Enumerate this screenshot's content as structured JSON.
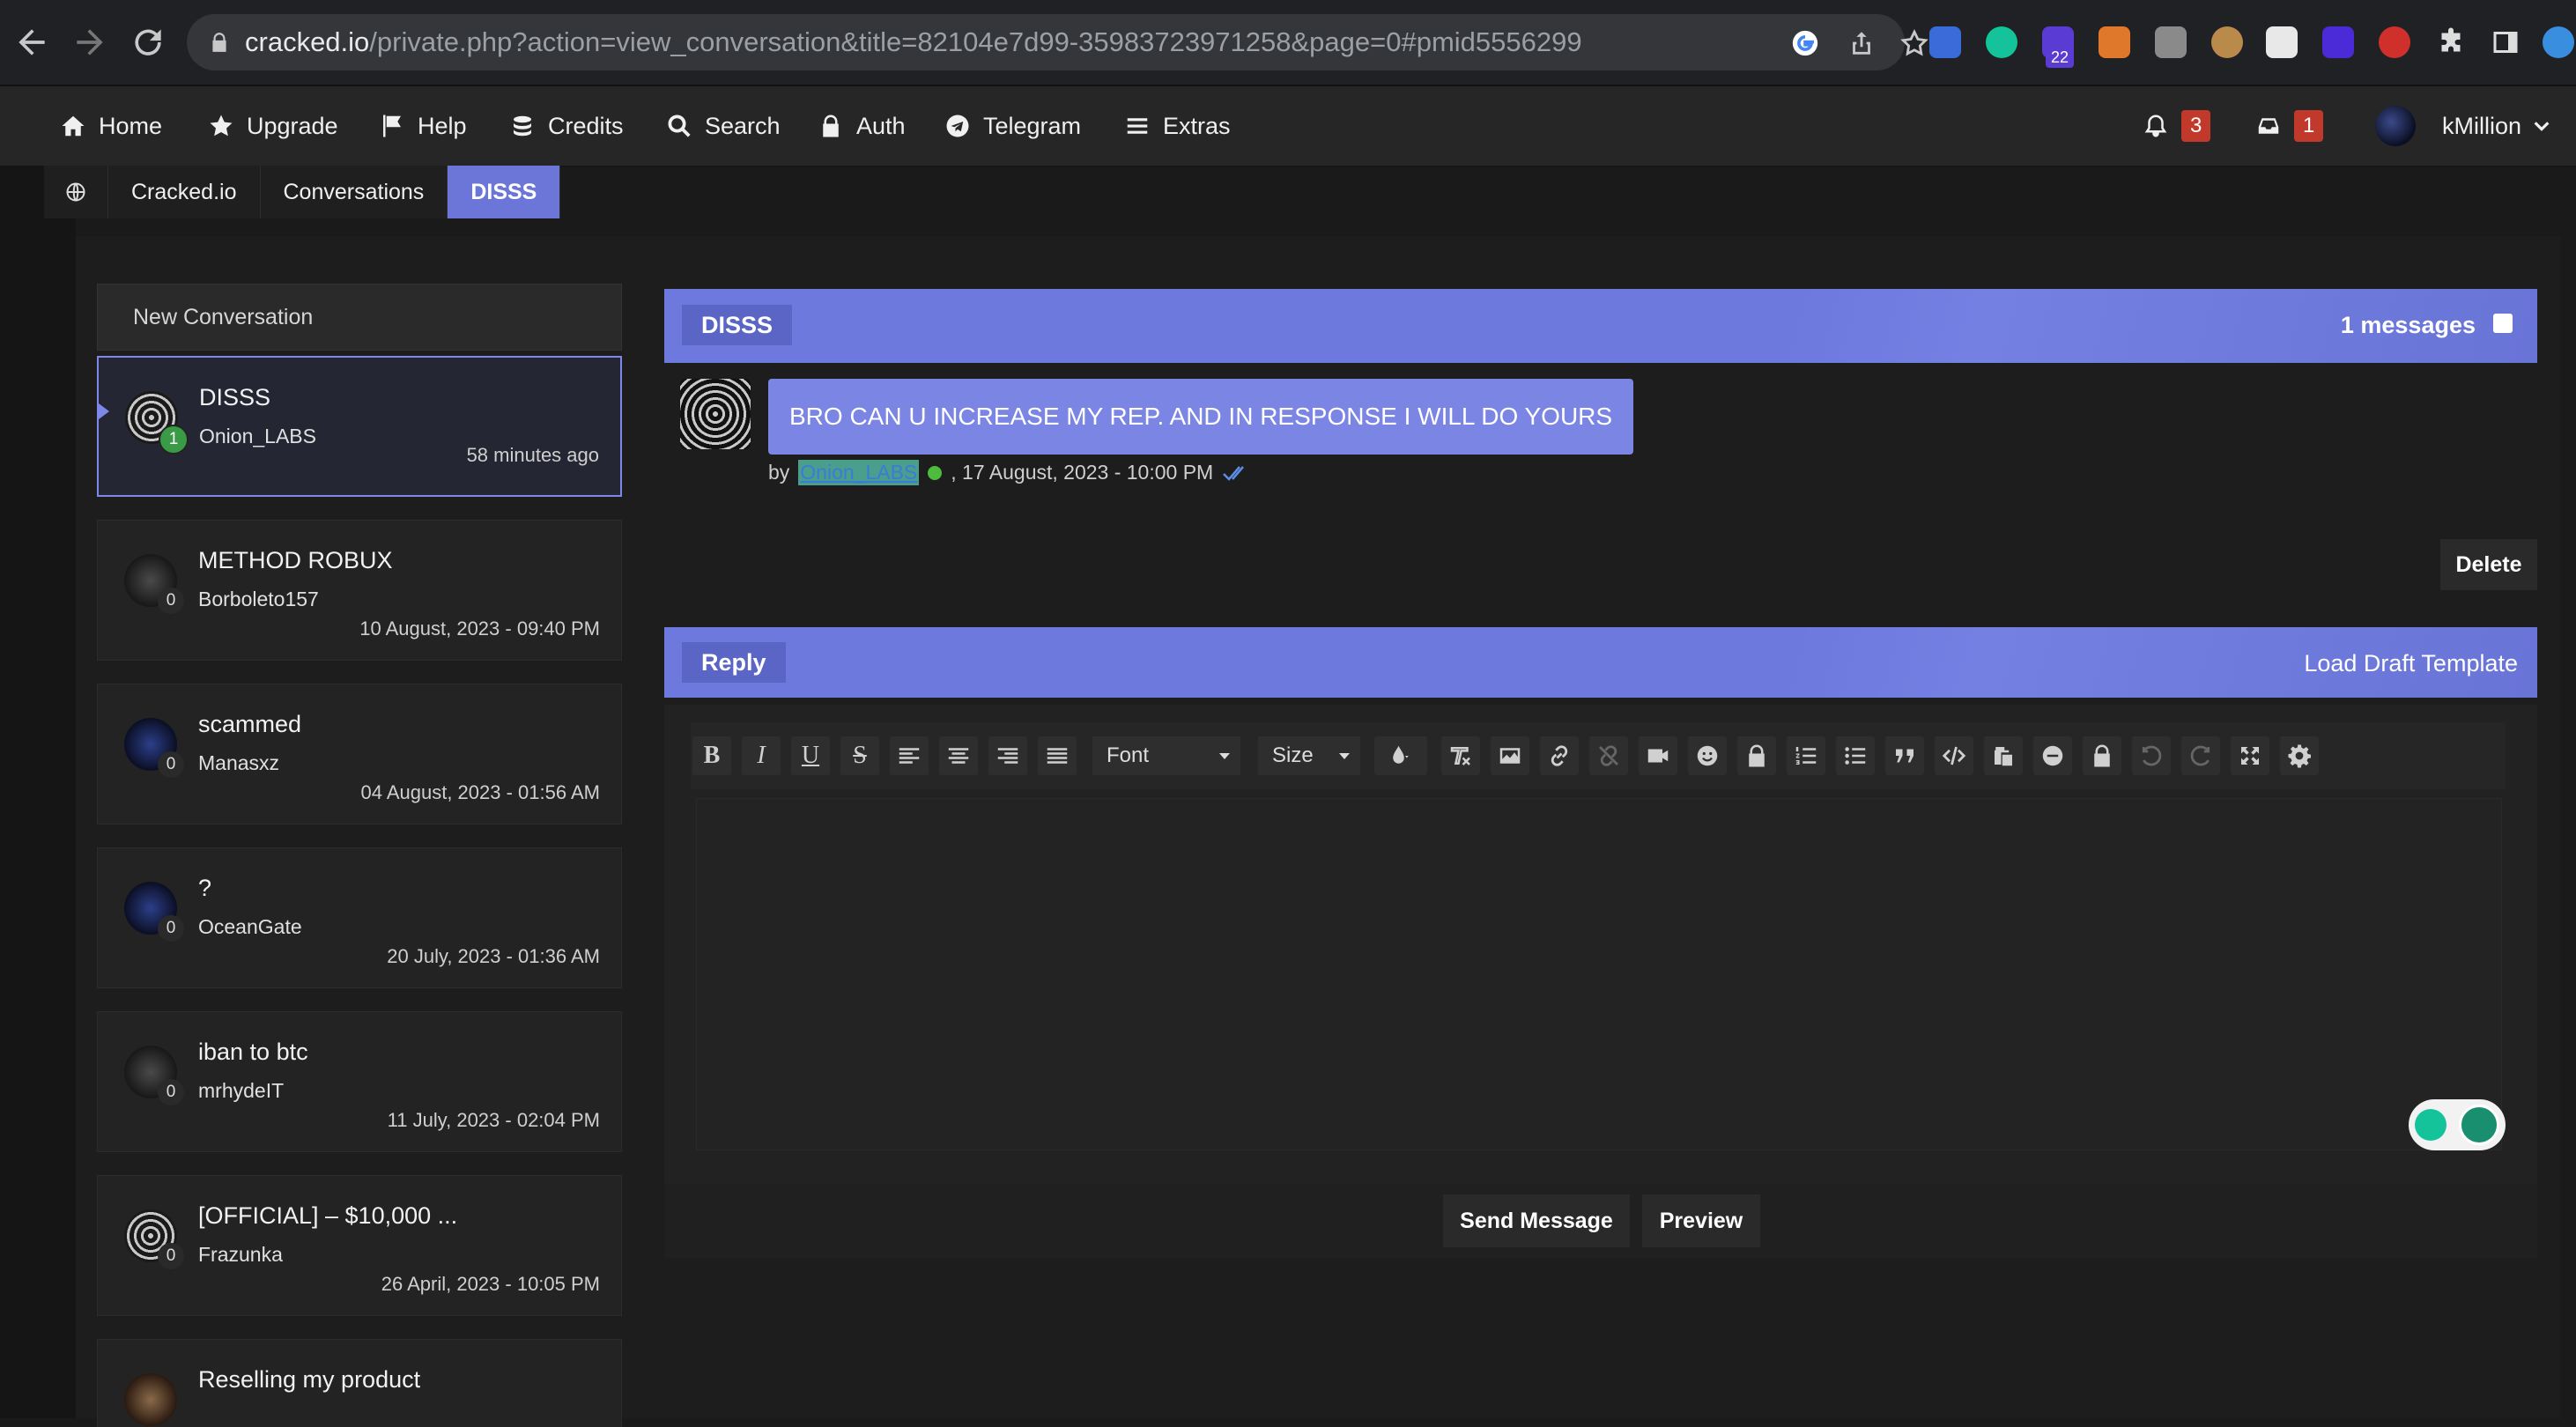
{
  "browser": {
    "url_host": "cracked.io",
    "url_path": "/private.php?action=view_conversation&title=82104e7d99-35983723971258&page=0#pmid5556299",
    "extension_badge": "22"
  },
  "nav": {
    "items": [
      {
        "label": "Home",
        "icon": "home-icon"
      },
      {
        "label": "Upgrade",
        "icon": "star-icon"
      },
      {
        "label": "Help",
        "icon": "flag-icon"
      },
      {
        "label": "Credits",
        "icon": "coins-icon"
      },
      {
        "label": "Search",
        "icon": "search-icon"
      },
      {
        "label": "Auth",
        "icon": "lock-icon"
      },
      {
        "label": "Telegram",
        "icon": "telegram-icon"
      },
      {
        "label": "Extras",
        "icon": "menu-icon"
      }
    ],
    "notifications_count": "3",
    "inbox_count": "1",
    "username": "kMillion"
  },
  "breadcrumb": [
    "Cracked.io",
    "Conversations",
    "DISSS"
  ],
  "conversations": {
    "new_label": "New Conversation",
    "items": [
      {
        "title": "DISSS",
        "user": "Onion_LABS",
        "time": "58 minutes ago",
        "count": "1"
      },
      {
        "title": "METHOD ROBUX",
        "user": "Borboleto157",
        "time": "10 August, 2023 - 09:40 PM",
        "count": "0"
      },
      {
        "title": "scammed",
        "user": "Manasxz",
        "time": "04 August, 2023 - 01:56 AM",
        "count": "0"
      },
      {
        "title": "?",
        "user": "OceanGate",
        "time": "20 July, 2023 - 01:36 AM",
        "count": "0"
      },
      {
        "title": "iban to btc",
        "user": "mrhydeIT",
        "time": "11 July, 2023 - 02:04 PM",
        "count": "0"
      },
      {
        "title": "[OFFICIAL] – $10,000 ...",
        "user": "Frazunka",
        "time": "26 April, 2023 - 10:05 PM",
        "count": "0"
      },
      {
        "title": "Reselling my product",
        "user": "",
        "time": "",
        "count": ""
      }
    ]
  },
  "thread": {
    "title": "DISSS",
    "messages_label": "1 messages",
    "message": {
      "text": "BRO CAN U  INCREASE MY REP. AND IN RESPONSE I WILL DO YOURS",
      "by": "by",
      "author": "Onion_LABS",
      "date": ", 17 August, 2023 - 10:00 PM"
    },
    "delete_label": "Delete"
  },
  "reply": {
    "title": "Reply",
    "load_draft_label": "Load Draft Template",
    "font_label": "Font",
    "size_label": "Size",
    "send_label": "Send Message",
    "preview_label": "Preview"
  },
  "colors": {
    "accent": "#6d79dd",
    "bubble": "#7b85e3",
    "badge_red": "#c0392b",
    "online": "#4dbb3c"
  }
}
